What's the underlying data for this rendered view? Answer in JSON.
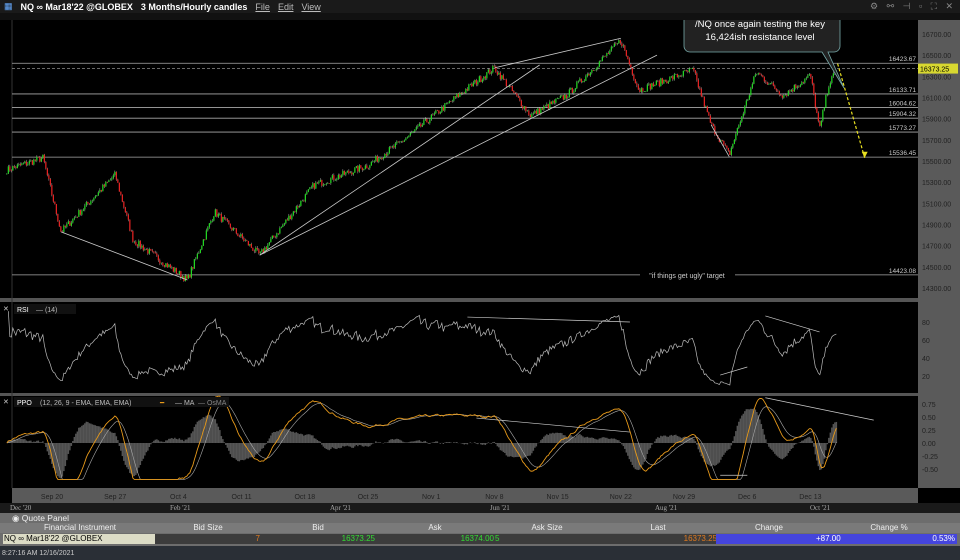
{
  "window": {
    "symbol": "NQ ∞ Mar18'22 @GLOBEX",
    "timeframe": "3 Months/Hourly candles",
    "menu": [
      "File",
      "Edit",
      "View"
    ],
    "controls": "⚙ ⚯ ⊣ ▫ ⛶ ✕"
  },
  "annotation": {
    "callout": [
      "/NQ once again testing the key",
      "16,424ish resistance level"
    ],
    "target_label": "\"if things get ugly\" target"
  },
  "colors": {
    "up": "#22dd22",
    "down": "#ee2222",
    "rsi": "#bbbbbb",
    "ppo": "#e89a1a",
    "arrow": "#e8e020",
    "last_price_bg": "#d8d830",
    "change_bg": "#4545dd"
  },
  "chart_data": [
    {
      "type": "candlestick",
      "title": "NQ ∞ Mar18'22 @GLOBEX",
      "ylim": [
        14200,
        16800
      ],
      "y_ticks": [
        "16700.00",
        "16500.00",
        "16300.00",
        "16100.00",
        "15900.00",
        "15700.00",
        "15500.00",
        "15300.00",
        "15100.00",
        "14900.00",
        "14700.00",
        "14500.00",
        "14300.00"
      ],
      "x_ticks": [
        "Sep 20",
        "Sep 27",
        "Oct 4",
        "Oct 11",
        "Oct 18",
        "Oct 25",
        "Nov 1",
        "Nov 8",
        "Nov 15",
        "Nov 22",
        "Nov 29",
        "Dec 6",
        "Dec 13"
      ],
      "x_start": "2021-09-20",
      "last_price": "16373.25",
      "levels": [
        {
          "value": "16423.67"
        },
        {
          "value": "16133.71"
        },
        {
          "value": "16004.62"
        },
        {
          "value": "15904.32"
        },
        {
          "value": "15773.27"
        },
        {
          "value": "15536.45"
        },
        {
          "value": "14423.08"
        }
      ],
      "approx_path": [
        [
          "2021-09-15",
          15415
        ],
        [
          "2021-09-19",
          15530
        ],
        [
          "2021-09-21",
          14830
        ],
        [
          "2021-09-27",
          15370
        ],
        [
          "2021-09-29",
          14750
        ],
        [
          "2021-10-05",
          14375
        ],
        [
          "2021-10-08",
          15020
        ],
        [
          "2021-10-13",
          14610
        ],
        [
          "2021-10-19",
          15270
        ],
        [
          "2021-10-25",
          15460
        ],
        [
          "2021-10-29",
          15700
        ],
        [
          "2021-11-04",
          16120
        ],
        [
          "2021-11-08",
          16380
        ],
        [
          "2021-11-12",
          15930
        ],
        [
          "2021-11-16",
          16120
        ],
        [
          "2021-11-22",
          16640
        ],
        [
          "2021-11-24",
          16170
        ],
        [
          "2021-11-30",
          16360
        ],
        [
          "2021-12-02",
          15840
        ],
        [
          "2021-12-04",
          15560
        ],
        [
          "2021-12-07",
          16340
        ],
        [
          "2021-12-10",
          16120
        ],
        [
          "2021-12-13",
          16310
        ],
        [
          "2021-12-14",
          15790
        ],
        [
          "2021-12-15",
          16220
        ],
        [
          "2021-12-16",
          16373
        ]
      ],
      "trendlines": [
        [
          [
            "2021-09-21",
            14830
          ],
          [
            "2021-10-05",
            14375
          ]
        ],
        [
          [
            "2021-10-13",
            14610
          ],
          [
            "2021-11-13",
            16407
          ]
        ],
        [
          [
            "2021-10-13",
            14610
          ],
          [
            "2021-11-26",
            16500
          ]
        ],
        [
          [
            "2021-11-08",
            16380
          ],
          [
            "2021-11-22",
            16660
          ]
        ],
        [
          [
            "2021-12-02",
            15840
          ],
          [
            "2021-12-04",
            15540
          ]
        ]
      ],
      "projection_arrow": [
        [
          "2021-12-16",
          16420
        ],
        [
          "2021-12-19",
          15530
        ]
      ]
    },
    {
      "type": "line",
      "name": "RSI",
      "legend": "RSI",
      "params": "(14)",
      "ylim": [
        0,
        100
      ],
      "y_ticks": [
        "80",
        "60",
        "40",
        "20"
      ],
      "trendlines": [
        [
          [
            "2021-11-05",
            85.5
          ],
          [
            "2021-11-23",
            80
          ]
        ],
        [
          [
            "2021-12-03",
            21
          ],
          [
            "2021-12-06",
            30
          ]
        ],
        [
          [
            "2021-12-08",
            86.7
          ],
          [
            "2021-12-14",
            69
          ]
        ]
      ]
    },
    {
      "type": "line",
      "name": "PPO",
      "legend": "PPO",
      "params": "(12, 26, 9 - EMA, EMA, EMA)",
      "series_labels": [
        "MA",
        "OsMA"
      ],
      "ylim": [
        -0.7,
        0.95
      ],
      "y_ticks": [
        "0.75",
        "0.50",
        "0.25",
        "0.00",
        "-0.25",
        "-0.50"
      ],
      "trendlines": [
        [
          [
            "2021-11-06",
            0.48
          ],
          [
            "2021-11-23",
            0.21
          ]
        ],
        [
          [
            "2021-12-08",
            0.87
          ],
          [
            "2021-12-20",
            0.44
          ]
        ],
        [
          [
            "2021-12-03",
            -0.62
          ],
          [
            "2021-12-06",
            -0.62
          ]
        ]
      ]
    }
  ],
  "scroller": [
    "Dec '20",
    "Feb '21",
    "Apr '21",
    "Jun '21",
    "Aug '21",
    "Oct '21"
  ],
  "quote_panel": {
    "title": "Quote Panel",
    "columns": [
      "Financial Instrument",
      "Bid Size",
      "Bid",
      "Ask",
      "Ask Size",
      "Last",
      "Change",
      "Change %"
    ],
    "row": {
      "instrument": "NQ ∞ Mar18'22 @GLOBEX",
      "bid_size": "7",
      "bid": "16373.25",
      "ask": "16374.00",
      "ask_size": "5",
      "last": "16373.25",
      "change": "+87.00",
      "change_pct": "0.53%"
    }
  },
  "status": {
    "time": "8:27:16 AM 12/16/2021"
  }
}
